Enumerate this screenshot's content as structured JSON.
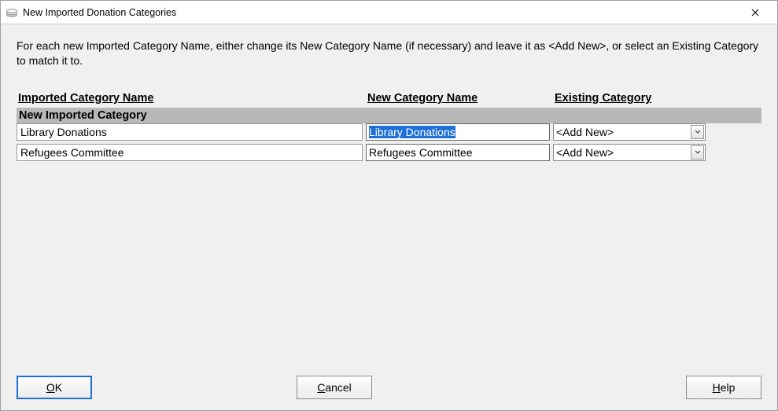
{
  "window": {
    "title": "New Imported Donation Categories"
  },
  "instructions": "For each new Imported Category Name, either change its New Category Name (if necessary) and leave it as <Add New>, or select an Existing Category to match it to.",
  "headers": {
    "imported": "Imported Category Name",
    "newcat": "New Category Name",
    "existing": "Existing Category"
  },
  "section_label": "New Imported Category",
  "rows": [
    {
      "imported": "Library Donations",
      "newcat": "Library Donations",
      "existing": "<Add New>",
      "selected": true
    },
    {
      "imported": "Refugees Committee",
      "newcat": "Refugees Committee",
      "existing": "<Add New>",
      "selected": false
    }
  ],
  "buttons": {
    "ok": "OK",
    "cancel": "Cancel",
    "help": "Help"
  }
}
